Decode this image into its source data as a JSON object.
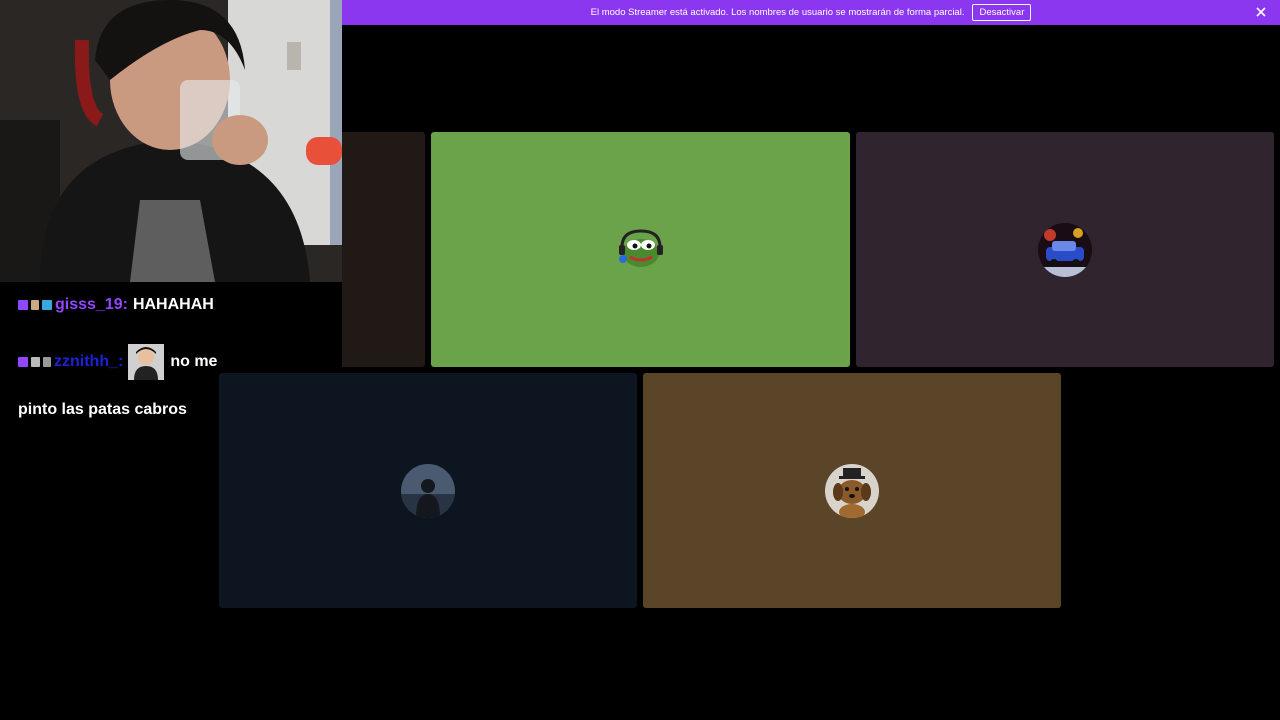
{
  "banner": {
    "text": "El modo Streamer está activado. Los nombres de usuario se mostrarán de forma parcial.",
    "button_label": "Desactivar",
    "close_icon": "close-icon",
    "color": "#8b37f0"
  },
  "tiles": [
    {
      "color": "#201915",
      "avatar": "none"
    },
    {
      "color": "#6ba34b",
      "avatar": "pepe-headset-avatar"
    },
    {
      "color": "#30242f",
      "avatar": "car-avatar"
    },
    {
      "color": "#0d1520",
      "avatar": "silhouette-avatar"
    },
    {
      "color": "#5a4528",
      "avatar": "dog-avatar"
    }
  ],
  "chat": {
    "messages": [
      {
        "username": "gisss_19:",
        "username_color": "#9146ff",
        "text": "HAHAHAH"
      },
      {
        "username": "zznithh_:",
        "username_color": "#1a22d8",
        "text": "no me"
      }
    ],
    "continuation": "pinto las patas cabros"
  }
}
